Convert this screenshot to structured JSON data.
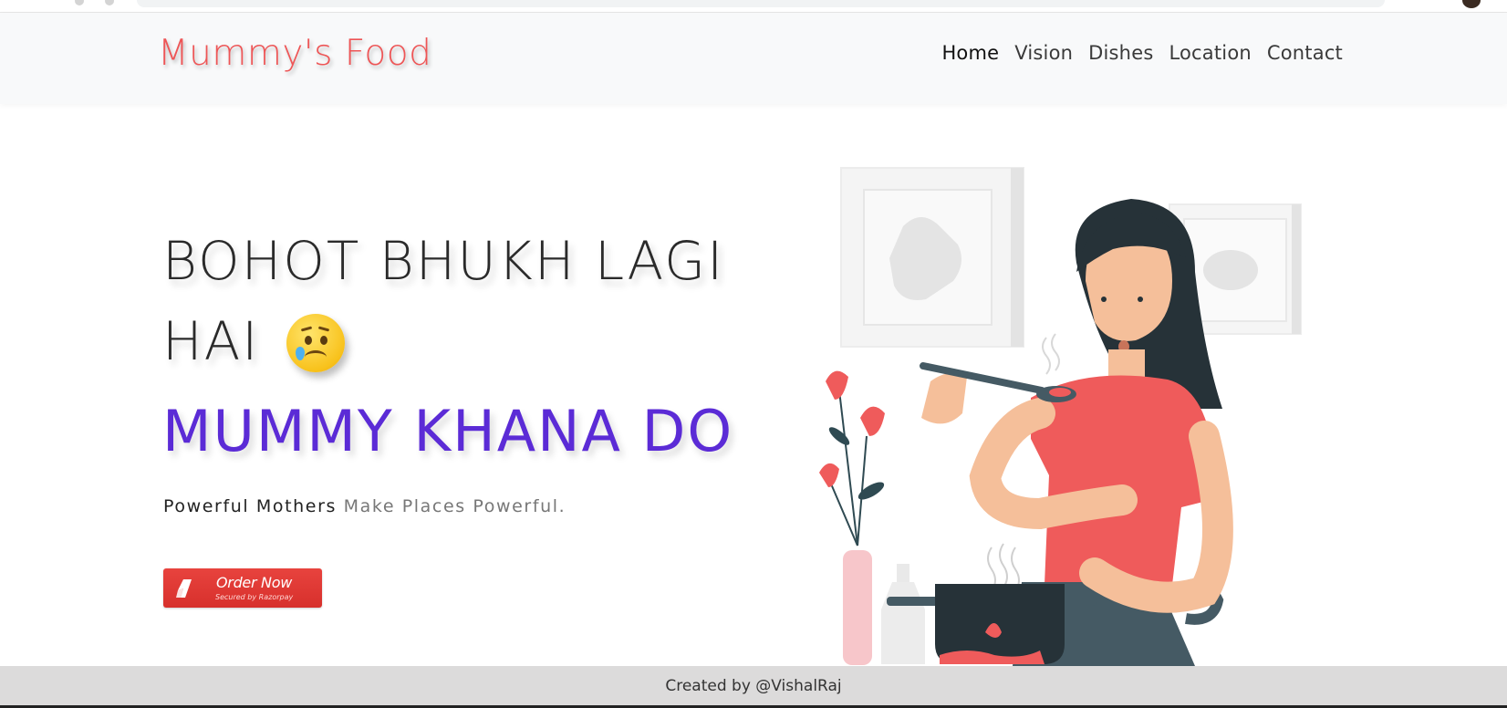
{
  "navbar": {
    "brand": "Mummy's Food",
    "links": [
      "Home",
      "Vision",
      "Dishes",
      "Location",
      "Contact"
    ]
  },
  "hero": {
    "line1": "BOHOT BHUKH LAGI",
    "line2": "HAI",
    "line2_emoji": "crying-face-icon",
    "line3": "MUMMY KHANA DO",
    "tagline_strong": "Powerful Mothers",
    "tagline_soft": "Make Places Powerful."
  },
  "order_button": {
    "label": "Order Now",
    "sublabel": "Secured by Razorpay",
    "icon": "razorpay-icon"
  },
  "illustration": {
    "icon": "woman-cooking-illustration"
  },
  "footer": {
    "text": "Created by @VishalRaj"
  },
  "colors": {
    "brand": "#ee5556",
    "accent_text": "#5b2bd6",
    "button": "#e23c38",
    "footer_bg": "#dcdbdb"
  }
}
